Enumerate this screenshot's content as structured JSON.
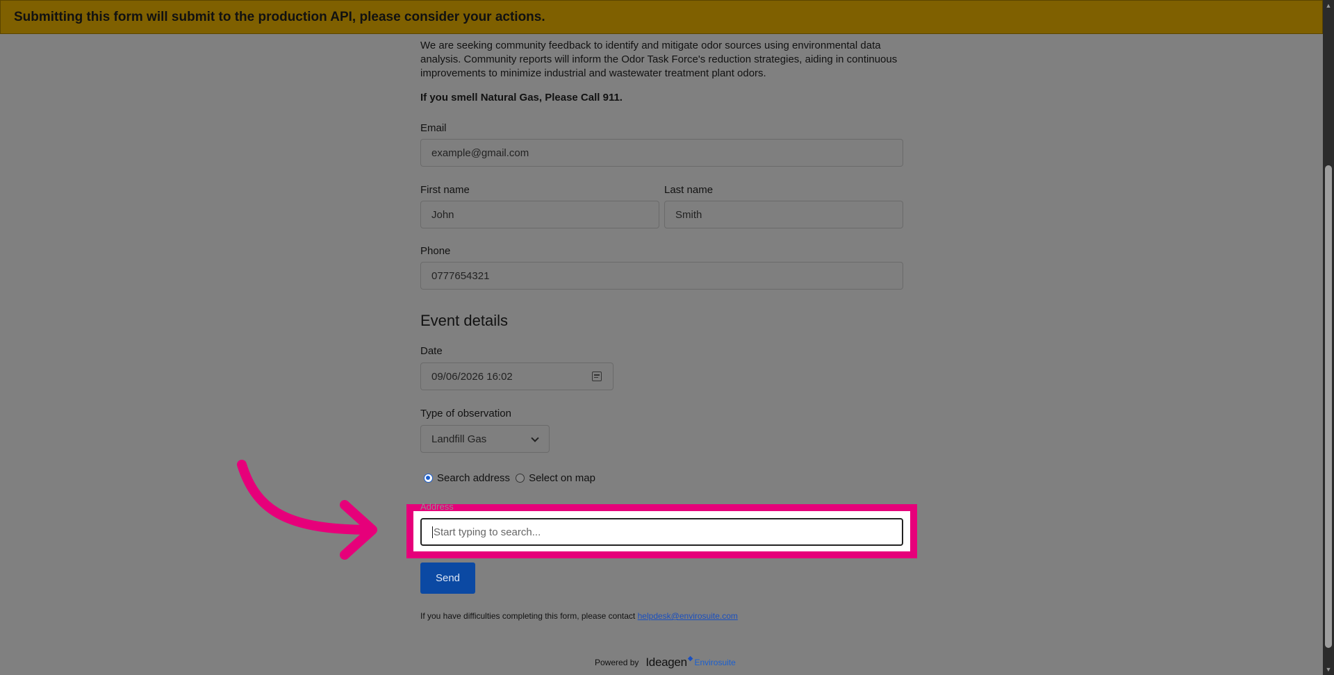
{
  "banner": {
    "text": "Submitting this form will submit to the production API, please consider your actions."
  },
  "intro": {
    "text": "We are seeking community feedback to identify and mitigate odor sources using environmental data analysis. Community reports will inform the Odor Task Force's reduction strategies, aiding in continuous improvements to minimize industrial and wastewater treatment plant odors.",
    "warning": "If you smell Natural Gas, Please Call 911."
  },
  "fields": {
    "email": {
      "label": "Email",
      "placeholder": "example@gmail.com"
    },
    "first_name": {
      "label": "First name",
      "placeholder": "John"
    },
    "last_name": {
      "label": "Last name",
      "placeholder": "Smith"
    },
    "phone": {
      "label": "Phone",
      "placeholder": "0777654321"
    }
  },
  "event": {
    "title": "Event details",
    "date": {
      "label": "Date",
      "value": "09/06/2026 16:02",
      "icon": "calendar-icon"
    },
    "observation": {
      "label": "Type of observation",
      "value": "Landfill Gas",
      "icon": "chevron-down-icon"
    },
    "location_mode": {
      "options": [
        "Search address",
        "Select on map"
      ],
      "selected": "Search address"
    },
    "address": {
      "label": "Address",
      "placeholder": "Start typing to search..."
    }
  },
  "send_label": "Send",
  "help": {
    "text": "If you have difficulties completing this form, please contact",
    "email": "helpdesk@envirosuite.com"
  },
  "footer": {
    "powered_by": "Powered by",
    "brand": "Ideagen",
    "sub_brand": "Envirosuite"
  },
  "colors": {
    "banner": "#7f6000",
    "highlight": "#e6007a",
    "send_button": "#0b49a3",
    "link": "#1a4fbf"
  }
}
